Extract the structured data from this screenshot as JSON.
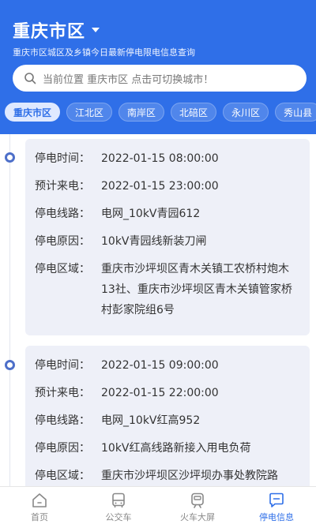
{
  "header": {
    "city": "重庆市区",
    "subtitle": "重庆市区城区及乡镇今日最新停电限电信息查询",
    "search_text": "当前位置 重庆市区 点击可切换城市！"
  },
  "tabs": [
    {
      "label": "重庆市区",
      "active": true
    },
    {
      "label": "江北区",
      "active": false
    },
    {
      "label": "南岸区",
      "active": false
    },
    {
      "label": "北碚区",
      "active": false
    },
    {
      "label": "永川区",
      "active": false
    },
    {
      "label": "秀山县",
      "active": false
    }
  ],
  "outages": [
    {
      "time_label": "停电时间：",
      "time": "2022-01-15 08:00:00",
      "restore_label": "预计来电：",
      "restore": "2022-01-15 23:00:00",
      "line_label": "停电线路：",
      "line": "电网_10kV青园612",
      "reason_label": "停电原因：",
      "reason": "10kV青园线新装刀闸",
      "area_label": "停电区域：",
      "area": "重庆市沙坪坝区青木关镇工农桥村炮木13社、重庆市沙坪坝区青木关镇管家桥村彭家院组6号"
    },
    {
      "time_label": "停电时间：",
      "time": "2022-01-15 09:00:00",
      "restore_label": "预计来电：",
      "restore": "2022-01-15 22:00:00",
      "line_label": "停电线路：",
      "line": "电网_10kV红高952",
      "reason_label": "停电原因：",
      "reason": "10kV红高线路新接入用电负荷",
      "area_label": "停电区域：",
      "area": "重庆市沙坪坝区沙坪坝办事处教院路"
    }
  ],
  "nav": [
    {
      "label": "首页",
      "icon": "home-icon",
      "active": false
    },
    {
      "label": "公交车",
      "icon": "bus-icon",
      "active": false
    },
    {
      "label": "火车大屏",
      "icon": "train-icon",
      "active": false
    },
    {
      "label": "停电信息",
      "icon": "chat-icon",
      "active": true
    }
  ],
  "colors": {
    "primary": "#2f6fe8",
    "card_bg": "#eef0f8",
    "dot": "#4d6fc9"
  }
}
